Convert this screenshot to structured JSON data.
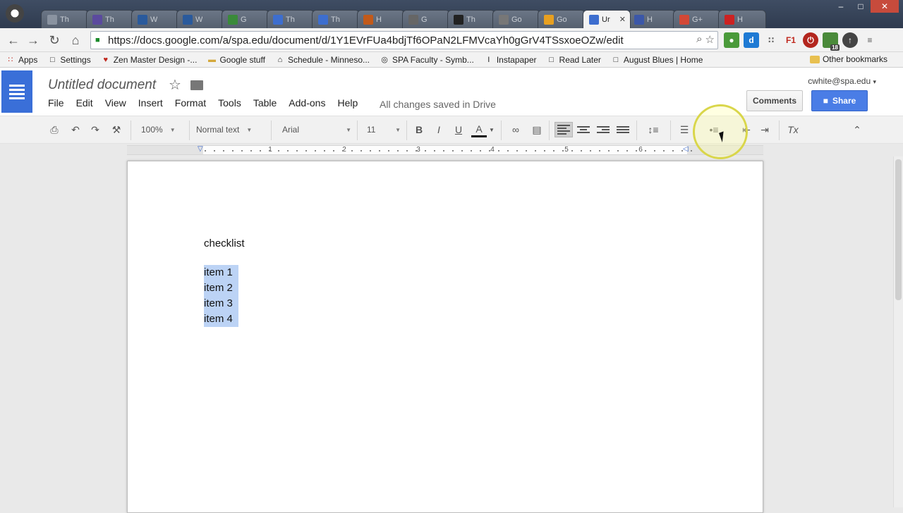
{
  "browser": {
    "url": "https://docs.google.com/a/spa.edu/document/d/1Y1EVrFUa4bdjTf6OPaN2LFMVcaYh0gGrV4TSsxoeOZw/edit",
    "active_tab_title": "Ur",
    "tabs": [
      {
        "title": "Th",
        "icon": "doc-icon",
        "color": "#8a93a0"
      },
      {
        "title": "Th",
        "icon": "th-icon",
        "color": "#5b4a9e"
      },
      {
        "title": "W",
        "icon": "wlc-icon",
        "color": "#2a5a9c"
      },
      {
        "title": "W",
        "icon": "wlc-icon",
        "color": "#2a5a9c"
      },
      {
        "title": "G",
        "icon": "google-icon",
        "color": "#3a8a3a"
      },
      {
        "title": "Th",
        "icon": "slides-icon",
        "color": "#3d6ecf"
      },
      {
        "title": "Th",
        "icon": "docs-icon",
        "color": "#3d6ecf"
      },
      {
        "title": "H",
        "icon": "edu-icon",
        "color": "#c25a1a"
      },
      {
        "title": "G",
        "icon": "globe-icon",
        "color": "#666"
      },
      {
        "title": "Th",
        "icon": "dark-icon",
        "color": "#222"
      },
      {
        "title": "Go",
        "icon": "drive-icon",
        "color": "#777"
      },
      {
        "title": "Go",
        "icon": "drive-color-icon",
        "color": "#e8a020"
      },
      {
        "title": "Ur",
        "icon": "docs-icon",
        "color": "#3d6ecf",
        "active": true
      },
      {
        "title": "H",
        "icon": "image-icon",
        "color": "#3b57a8"
      },
      {
        "title": "G+",
        "icon": "gplus-icon",
        "color": "#d34836"
      },
      {
        "title": "H",
        "icon": "youtube-icon",
        "color": "#cc2222"
      }
    ],
    "bookmarks": [
      {
        "label": "Apps",
        "icon": "apps-grid-icon"
      },
      {
        "label": "Settings",
        "icon": "page-icon"
      },
      {
        "label": "Zen Master Design -...",
        "icon": "heart-icon"
      },
      {
        "label": "Google stuff",
        "icon": "folder-icon"
      },
      {
        "label": "Schedule - Minneso...",
        "icon": "building-icon"
      },
      {
        "label": "SPA Faculty - Symb...",
        "icon": "globe-icon"
      },
      {
        "label": "Instapaper",
        "icon": "instapaper-icon"
      },
      {
        "label": "Read Later",
        "icon": "page-icon"
      },
      {
        "label": "August Blues | Home",
        "icon": "page-icon"
      }
    ],
    "other_bookmarks": "Other bookmarks",
    "extension_badge": "18"
  },
  "docs": {
    "title": "Untitled document",
    "user": "cwhite@spa.edu",
    "menus": [
      "File",
      "Edit",
      "View",
      "Insert",
      "Format",
      "Tools",
      "Table",
      "Add-ons",
      "Help"
    ],
    "save_status": "All changes saved in Drive",
    "comments_label": "Comments",
    "share_label": "Share",
    "toolbar": {
      "zoom": "100%",
      "style": "Normal text",
      "font": "Arial",
      "size": "11",
      "bold": "B",
      "italic": "I",
      "underline": "U",
      "text_color": "A",
      "clear_format": "Tx"
    },
    "ruler_numbers": [
      "1",
      "2",
      "3",
      "4",
      "5",
      "6"
    ],
    "document": {
      "heading": "checklist",
      "items": [
        "item 1",
        "item 2",
        "item 3",
        "item 4"
      ]
    }
  },
  "colors": {
    "selection": "#bcd3f5",
    "share_blue": "#4a7de6",
    "docs_blue": "#3a6fd8",
    "cursor_highlight": "#d9d64a"
  }
}
